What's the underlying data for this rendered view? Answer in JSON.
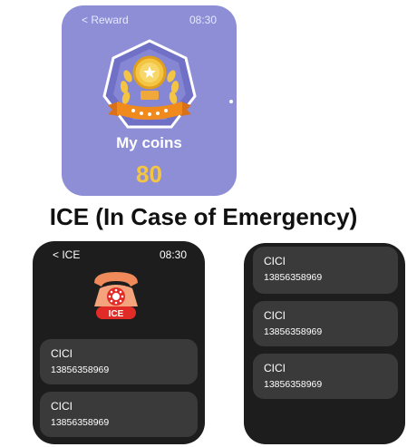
{
  "reward_screen": {
    "back_label": "< Reward",
    "time": "08:30",
    "coins_label": "My coins",
    "coins_value": "80"
  },
  "section_title": "ICE (In Case of Emergency)",
  "ice_screen": {
    "back_label": "< ICE",
    "time": "08:30",
    "icon_badge": "ICE",
    "contacts": [
      {
        "name": "CICI",
        "phone": "13856358969"
      },
      {
        "name": "CICI",
        "phone": "13856358969"
      }
    ]
  },
  "ice_list_screen": {
    "contacts": [
      {
        "name": "CICI",
        "phone": "13856358969"
      },
      {
        "name": "CICI",
        "phone": "13856358969"
      },
      {
        "name": "CICI",
        "phone": "13856358969"
      }
    ]
  },
  "colors": {
    "reward_bg": "#8d8ed6",
    "coin_gold": "#f4c542",
    "ribbon_orange": "#f08a1c",
    "dark_bg": "#1d1d1d",
    "card_bg": "#3a3a3a",
    "ice_red": "#e02b27"
  }
}
